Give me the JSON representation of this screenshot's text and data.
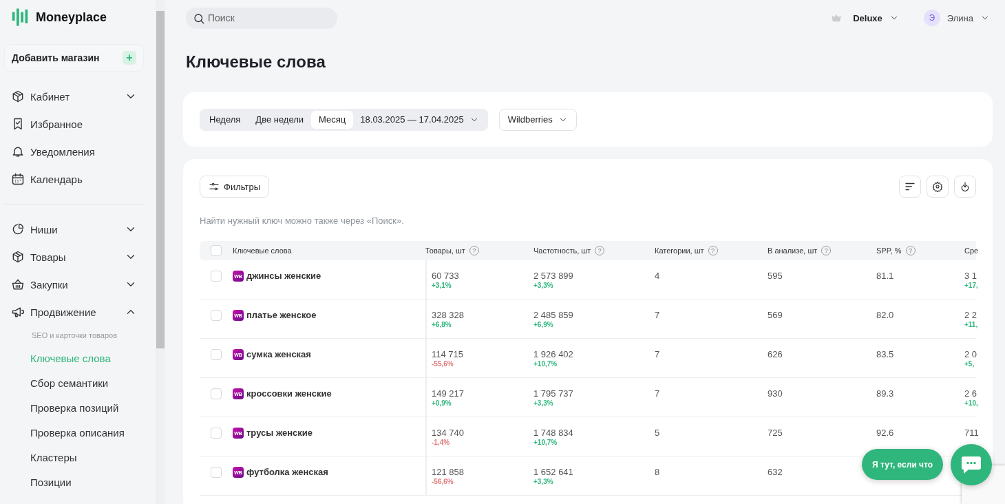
{
  "sidebar": {
    "logo": "Moneyplace",
    "add_store": {
      "label": "Добавить магазин",
      "icon": "+"
    },
    "sections": [
      {
        "items": [
          {
            "label": "Кабинет",
            "kind": "group",
            "expanded": false
          },
          {
            "label": "Избранное",
            "kind": "link"
          },
          {
            "label": "Уведомления",
            "kind": "link"
          },
          {
            "label": "Календарь",
            "kind": "link"
          }
        ]
      },
      {
        "items": [
          {
            "label": "Ниши",
            "kind": "group",
            "expanded": false
          },
          {
            "label": "Товары",
            "kind": "group",
            "expanded": false
          },
          {
            "label": "Закупки",
            "kind": "group",
            "expanded": false
          },
          {
            "label": "Продвижение",
            "kind": "group",
            "expanded": true,
            "subheading": "SEO и карточки товаров",
            "children": [
              {
                "label": "Ключевые слова",
                "selected": true
              },
              {
                "label": "Сбор семантики",
                "selected": false
              },
              {
                "label": "Проверка позиций",
                "selected": false
              },
              {
                "label": "Проверка описания",
                "selected": false
              },
              {
                "label": "Кластеры",
                "selected": false
              },
              {
                "label": "Позиции",
                "selected": false
              }
            ]
          }
        ]
      }
    ]
  },
  "topbar": {
    "search": {
      "placeholder": "Поиск"
    },
    "plan": "Deluxe",
    "user": {
      "initial": "Э",
      "name": "Элина"
    }
  },
  "page_title": "Ключевые слова",
  "period": {
    "options": [
      {
        "label": "Неделя",
        "selected": false
      },
      {
        "label": "Две недели",
        "selected": false
      },
      {
        "label": "Месяц",
        "selected": true
      }
    ],
    "date_range": "18.03.2025 — 17.04.2025",
    "marketplace": "Wildberries"
  },
  "toolbar": {
    "filters": "Фильтры",
    "hint": "Найти нужный ключ можно также через «Поиск»."
  },
  "table": {
    "header_checked": false,
    "columns": [
      {
        "label": "Ключевые слова"
      },
      {
        "label": "Товары, шт",
        "help_icon": "?"
      },
      {
        "label": "Частотность, шт",
        "help_icon": "?"
      },
      {
        "label": "Категории, шт",
        "help_icon": "?"
      },
      {
        "label": "В анализе, шт",
        "help_icon": "?"
      },
      {
        "label": "SPP, %",
        "help_icon": "?"
      },
      {
        "label": "Сре"
      }
    ],
    "rows": [
      {
        "checked": false,
        "badge": "WB",
        "keyword": "джинсы женские",
        "goods": {
          "value": "60 733",
          "delta": "+3,1%",
          "color": "#2fb67c"
        },
        "frequency": {
          "value": "2 573 899",
          "delta": "+3,3%",
          "color": "#2fb67c"
        },
        "categories": "4",
        "in_analysis": "595",
        "spp": "81.1",
        "column_7": {
          "value": "3 1",
          "delta": "+17,",
          "color": "#2fb67c"
        }
      },
      {
        "checked": false,
        "badge": "WB",
        "keyword": "платье женское",
        "goods": {
          "value": "328 328",
          "delta": "+6,8%",
          "color": "#2fb67c"
        },
        "frequency": {
          "value": "2 485 859",
          "delta": "+6,9%",
          "color": "#2fb67c"
        },
        "categories": "7",
        "in_analysis": "569",
        "spp": "82.0",
        "column_7": {
          "value": "2 2",
          "delta": "+11,",
          "color": "#2fb67c"
        }
      },
      {
        "checked": false,
        "badge": "WB",
        "keyword": "сумка женская",
        "goods": {
          "value": "114 715",
          "delta": "-55,6%",
          "color": "#e0787a"
        },
        "frequency": {
          "value": "1 926 402",
          "delta": "+10,7%",
          "color": "#2fb67c"
        },
        "categories": "7",
        "in_analysis": "626",
        "spp": "83.5",
        "column_7": {
          "value": "2 0",
          "delta": "+5,",
          "color": "#2fb67c"
        }
      },
      {
        "checked": false,
        "badge": "WB",
        "keyword": "кроссовки женские",
        "goods": {
          "value": "149 217",
          "delta": "+0,9%",
          "color": "#2fb67c"
        },
        "frequency": {
          "value": "1 795 737",
          "delta": "+3,3%",
          "color": "#2fb67c"
        },
        "categories": "7",
        "in_analysis": "930",
        "spp": "89.3",
        "column_7": {
          "value": "2 6",
          "delta": "+10,",
          "color": "#2fb67c"
        }
      },
      {
        "checked": false,
        "badge": "WB",
        "keyword": "трусы женские",
        "goods": {
          "value": "134 740",
          "delta": "-1,4%",
          "color": "#e0787a"
        },
        "frequency": {
          "value": "1 748 834",
          "delta": "+10,7%",
          "color": "#2fb67c"
        },
        "categories": "5",
        "in_analysis": "725",
        "spp": "92.6",
        "column_7": {
          "value": "711"
        }
      },
      {
        "checked": false,
        "badge": "WB",
        "keyword": "футболка женская",
        "goods": {
          "value": "121 858",
          "delta": "-56,6%",
          "color": "#e0787a"
        },
        "frequency": {
          "value": "1 652 641",
          "delta": "+3,3%",
          "color": "#2fb67c"
        },
        "categories": "8",
        "in_analysis": "632"
      }
    ]
  },
  "chat": {
    "label": "Я тут, если что"
  }
}
